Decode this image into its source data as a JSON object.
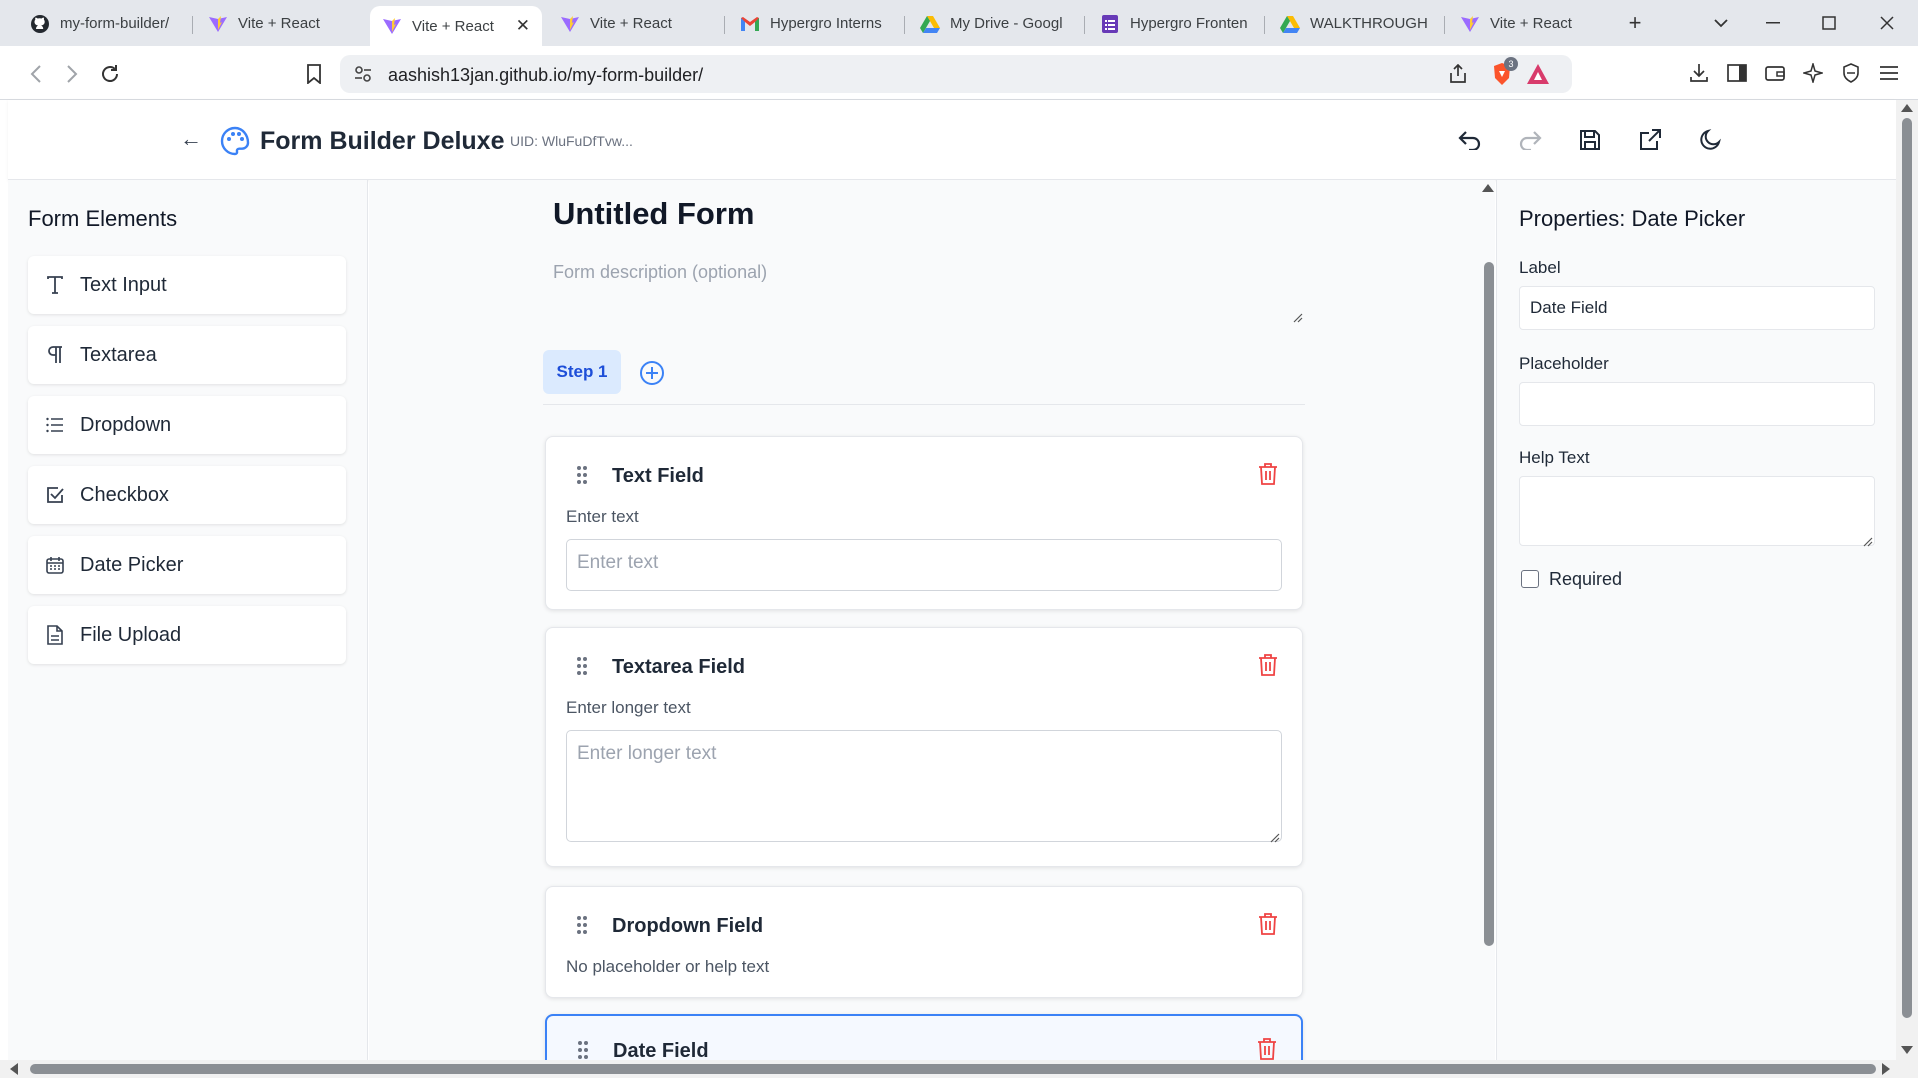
{
  "browser": {
    "tabs": [
      {
        "title": "my-form-builder/",
        "icon": "github-icon"
      },
      {
        "title": "Vite + React",
        "icon": "vite-icon"
      },
      {
        "title": "Vite + React",
        "icon": "vite-icon",
        "active": true
      },
      {
        "title": "Vite + React",
        "icon": "vite-icon"
      },
      {
        "title": "Hypergro Interns",
        "icon": "gmail-icon"
      },
      {
        "title": "My Drive - Googl",
        "icon": "google-drive-icon"
      },
      {
        "title": "Hypergro Fronten",
        "icon": "google-forms-icon"
      },
      {
        "title": "WALKTHROUGH",
        "icon": "google-drive-icon"
      },
      {
        "title": "Vite + React",
        "icon": "vite-icon"
      }
    ],
    "url": "aashish13jan.github.io/my-form-builder/",
    "shield_badge": "3"
  },
  "app": {
    "title": "Form Builder Deluxe",
    "uid": "UID: WluFuDfTvw..."
  },
  "sidebar": {
    "heading": "Form Elements",
    "items": [
      {
        "label": "Text Input",
        "icon": "text-icon"
      },
      {
        "label": "Textarea",
        "icon": "paragraph-icon"
      },
      {
        "label": "Dropdown",
        "icon": "list-icon"
      },
      {
        "label": "Checkbox",
        "icon": "checkbox-icon"
      },
      {
        "label": "Date Picker",
        "icon": "calendar-icon"
      },
      {
        "label": "File Upload",
        "icon": "file-icon"
      }
    ]
  },
  "form": {
    "title": "Untitled Form",
    "description_placeholder": "Form description (optional)",
    "steps": [
      "Step 1"
    ],
    "fields": [
      {
        "name": "Text Field",
        "label": "Enter text",
        "placeholder": "Enter text"
      },
      {
        "name": "Textarea Field",
        "label": "Enter longer text",
        "placeholder": "Enter longer text"
      },
      {
        "name": "Dropdown Field",
        "label": "No placeholder or help text"
      },
      {
        "name": "Date Field"
      }
    ]
  },
  "properties": {
    "heading": "Properties: Date Picker",
    "label_title": "Label",
    "label_value": "Date Field",
    "placeholder_title": "Placeholder",
    "placeholder_value": "",
    "help_title": "Help Text",
    "required_label": "Required",
    "required": false
  },
  "colors": {
    "accent": "#3b82f6",
    "delete": "#ef4444",
    "step_bg": "#dbeafe"
  }
}
